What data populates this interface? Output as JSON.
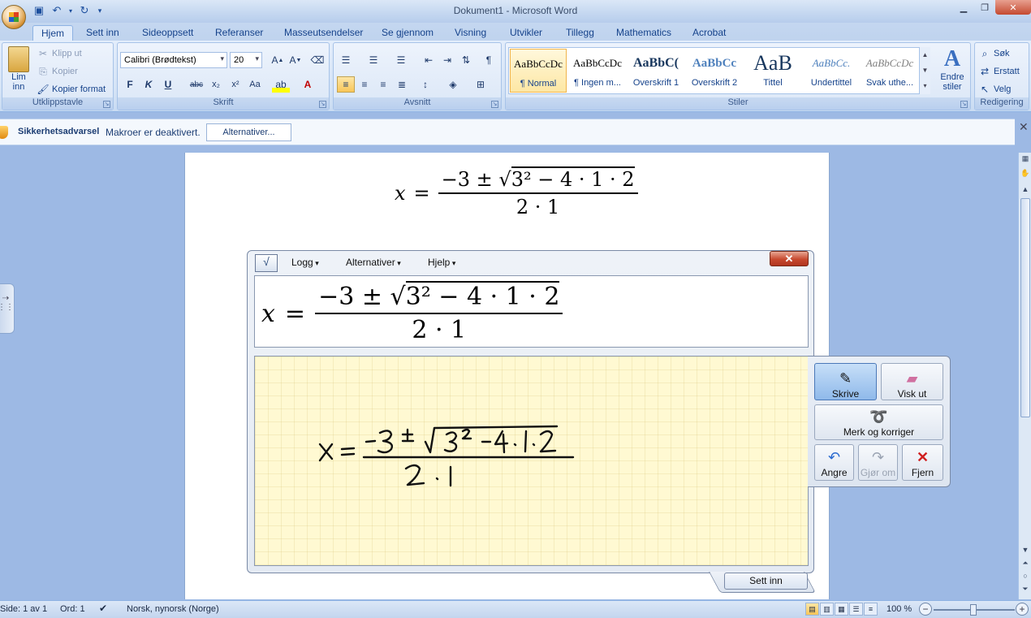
{
  "window": {
    "title": "Dokument1 - Microsoft Word"
  },
  "qat": {
    "icons": [
      "save-icon",
      "undo-icon",
      "redo-icon",
      "customize-icon"
    ]
  },
  "tabs": [
    "Hjem",
    "Sett inn",
    "Sideoppsett",
    "Referanser",
    "Masseutsendelser",
    "Se gjennom",
    "Visning",
    "Utvikler",
    "Tillegg",
    "Mathematics",
    "Acrobat"
  ],
  "active_tab": "Hjem",
  "ribbon": {
    "clipboard": {
      "label": "Utklippstavle",
      "paste": "Lim",
      "paste2": "inn",
      "cut": "Klipp ut",
      "copy": "Kopier",
      "format_painter": "Kopier format"
    },
    "font": {
      "label": "Skrift",
      "family": "Calibri (Brødtekst)",
      "size": "20"
    },
    "paragraph": {
      "label": "Avsnitt"
    },
    "styles": {
      "label": "Stiler",
      "items": [
        {
          "sample": "AaBbCcDc",
          "name": "¶ Normal"
        },
        {
          "sample": "AaBbCcDc",
          "name": "¶ Ingen m..."
        },
        {
          "sample": "AaBbC(",
          "name": "Overskrift 1"
        },
        {
          "sample": "AaBbCc",
          "name": "Overskrift 2"
        },
        {
          "sample": "AaB",
          "name": "Tittel"
        },
        {
          "sample": "AaBbCc.",
          "name": "Undertittel"
        },
        {
          "sample": "AaBbCcDc",
          "name": "Svak uthe..."
        }
      ],
      "change": "Endre",
      "change2": "stiler"
    },
    "editing": {
      "label": "Redigering",
      "find": "Søk",
      "replace": "Erstatt",
      "select": "Velg"
    }
  },
  "security": {
    "title": "Sikkerhetsadvarsel",
    "message": "Makroer er deaktivert.",
    "button": "Alternativer..."
  },
  "document": {
    "equation": {
      "lhs": "x",
      "eq": "=",
      "num_pre": "−3 ± ",
      "radical": "√",
      "num_rad": "3² − 4 · 1 · 2",
      "den": "2 · 1"
    }
  },
  "math_panel": {
    "menus": [
      "Logg",
      "Alternativer",
      "Hjelp"
    ],
    "close": "✕",
    "preview": {
      "lhs": "x",
      "eq": "=",
      "num_pre": "−3 ± ",
      "radical": "√",
      "num_rad": "3² − 4 · 1 · 2",
      "den": "2 · 1"
    },
    "insert": "Sett inn",
    "tools": {
      "write": "Skrive",
      "erase": "Visk ut",
      "select_correct": "Merk og korriger",
      "undo": "Angre",
      "redo": "Gjør om",
      "clear": "Fjern"
    }
  },
  "statusbar": {
    "page": "Side: 1 av 1",
    "words": "Ord: 1",
    "language": "Norsk, nynorsk (Norge)",
    "zoom": "100 %",
    "zoom_level": 1.0
  }
}
